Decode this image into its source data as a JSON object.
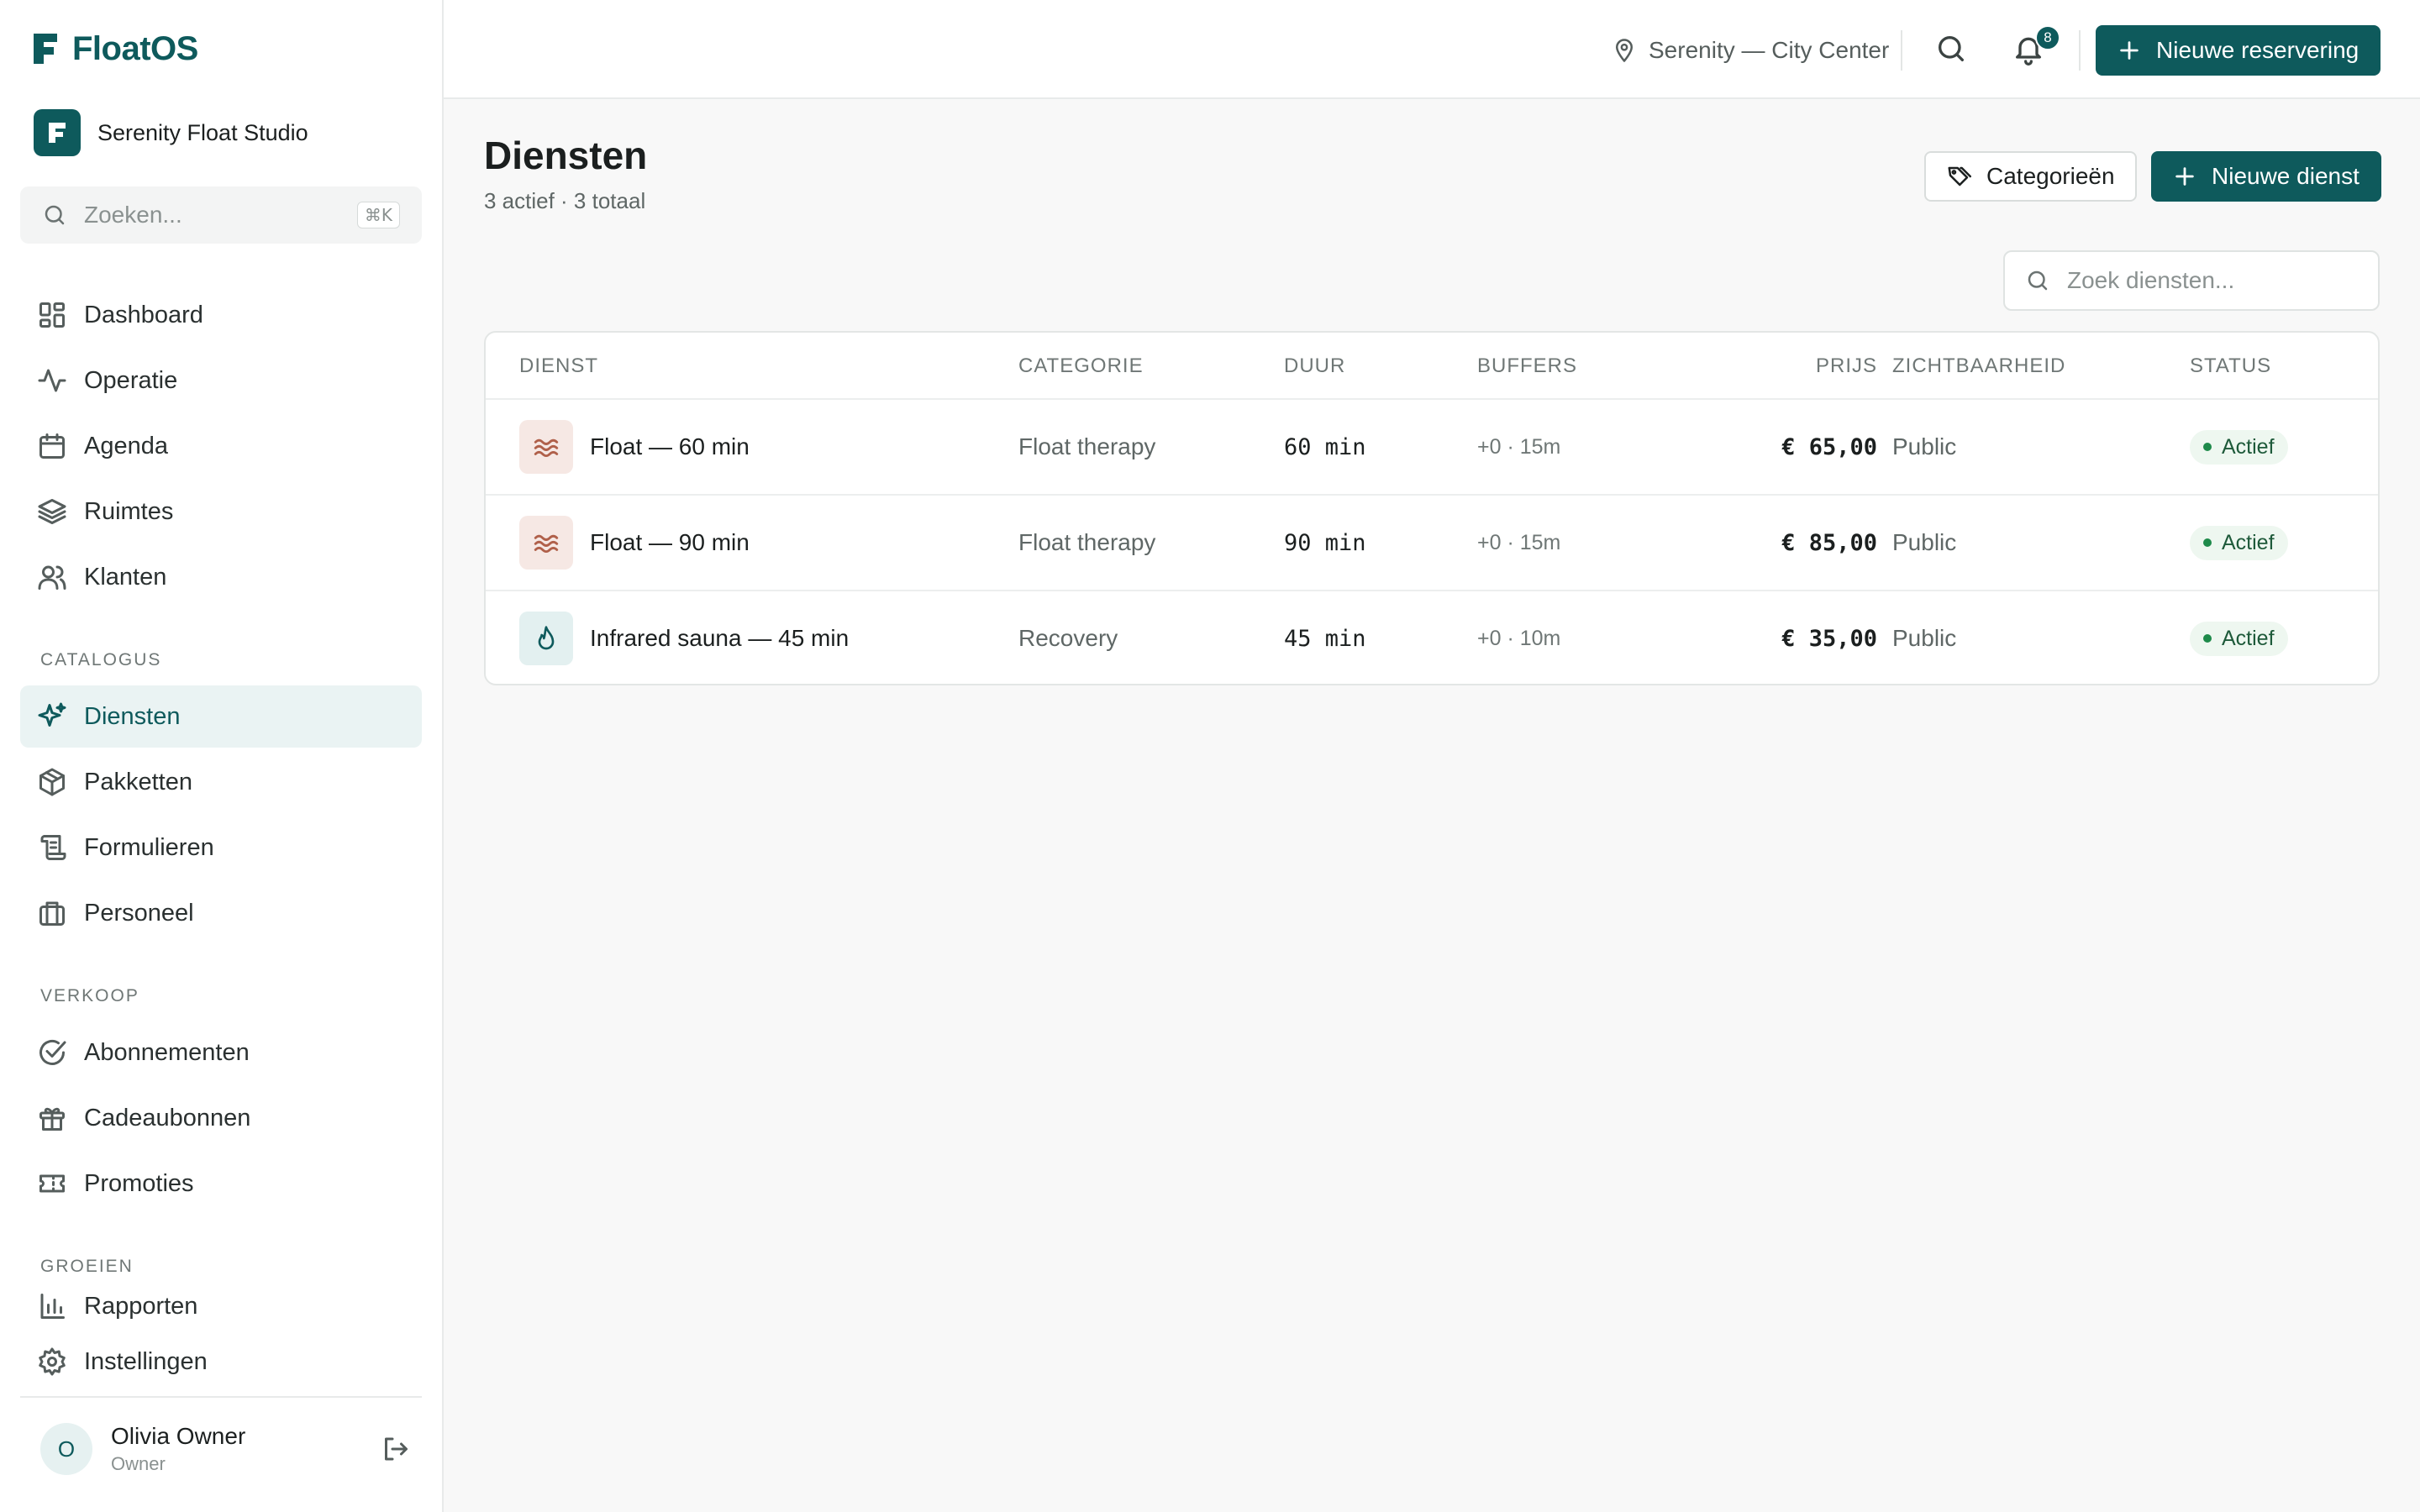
{
  "app": {
    "name": "FloatOS"
  },
  "org": {
    "name": "Serenity Float Studio"
  },
  "sidebar": {
    "search_placeholder": "Zoeken...",
    "search_shortcut": "⌘K",
    "main_items": [
      {
        "label": "Dashboard",
        "icon": "dashboard-icon"
      },
      {
        "label": "Operatie",
        "icon": "activity-icon"
      },
      {
        "label": "Agenda",
        "icon": "calendar-icon"
      },
      {
        "label": "Ruimtes",
        "icon": "layers-icon"
      },
      {
        "label": "Klanten",
        "icon": "users-icon"
      }
    ],
    "sections": [
      {
        "label": "CATALOGUS",
        "items": [
          {
            "label": "Diensten",
            "icon": "sparkles-icon",
            "active": true
          },
          {
            "label": "Pakketten",
            "icon": "package-icon"
          },
          {
            "label": "Formulieren",
            "icon": "scroll-icon"
          },
          {
            "label": "Personeel",
            "icon": "briefcase-icon"
          }
        ]
      },
      {
        "label": "VERKOOP",
        "items": [
          {
            "label": "Abonnementen",
            "icon": "check-circle-icon"
          },
          {
            "label": "Cadeaubonnen",
            "icon": "gift-icon"
          },
          {
            "label": "Promoties",
            "icon": "ticket-icon"
          }
        ]
      },
      {
        "label": "GROEIEN",
        "items": [
          {
            "label": "Rapporten",
            "icon": "bar-chart-icon"
          }
        ]
      }
    ],
    "settings_label": "Instellingen",
    "user": {
      "initial": "O",
      "name": "Olivia Owner",
      "role": "Owner"
    }
  },
  "topbar": {
    "location": "Serenity — City Center",
    "notification_count": "8",
    "new_booking_label": "Nieuwe reservering"
  },
  "page": {
    "title": "Diensten",
    "subtitle": "3 actief · 3 totaal",
    "categories_label": "Categorieën",
    "new_service_label": "Nieuwe dienst",
    "search_placeholder": "Zoek diensten..."
  },
  "table": {
    "headers": {
      "service": "DIENST",
      "category": "CATEGORIE",
      "duration": "DUUR",
      "buffers": "BUFFERS",
      "price": "PRIJS",
      "visibility": "ZICHTBAARHEID",
      "status": "STATUS"
    },
    "rows": [
      {
        "name": "Float — 60 min",
        "icon": "waves-icon",
        "icon_bg": "#f6e8e4",
        "icon_color": "#b0604a",
        "category": "Float therapy",
        "duration": "60 min",
        "buffers": "+0 · 15m",
        "price": "€ 65,00",
        "visibility": "Public",
        "status": "Actief"
      },
      {
        "name": "Float — 90 min",
        "icon": "waves-icon",
        "icon_bg": "#f6e8e4",
        "icon_color": "#b0604a",
        "category": "Float therapy",
        "duration": "90 min",
        "buffers": "+0 · 15m",
        "price": "€ 85,00",
        "visibility": "Public",
        "status": "Actief"
      },
      {
        "name": "Infrared sauna — 45 min",
        "icon": "flame-icon",
        "icon_bg": "#e3f0f0",
        "icon_color": "#0e5a5c",
        "category": "Recovery",
        "duration": "45 min",
        "buffers": "+0 · 10m",
        "price": "€ 35,00",
        "visibility": "Public",
        "status": "Actief"
      }
    ]
  },
  "colors": {
    "brand": "#0e5a5c",
    "active_nav_bg": "#eaf3f3",
    "status_bg": "#eef7f0",
    "status_dot": "#1e8a4a"
  }
}
